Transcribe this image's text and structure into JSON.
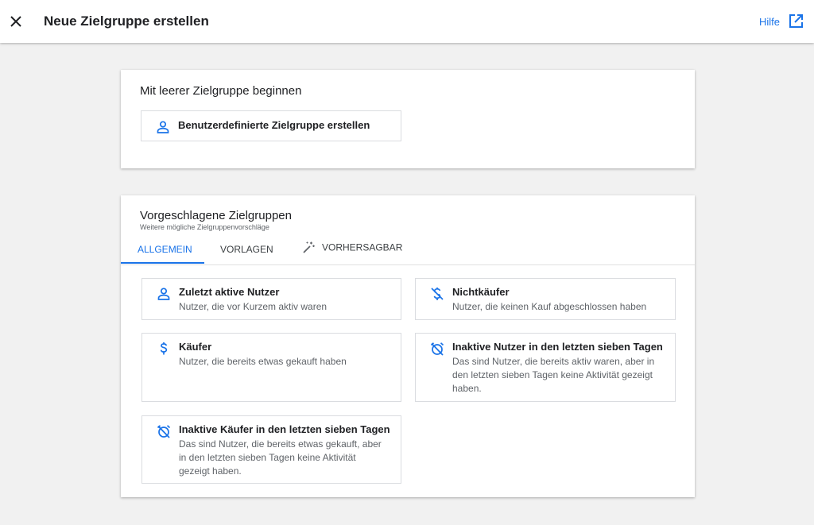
{
  "header": {
    "title": "Neue Zielgruppe erstellen",
    "close_icon": "close-icon",
    "help_label": "Hilfe",
    "help_icon": "open-in-new-icon"
  },
  "blank_section": {
    "title": "Mit leerer Zielgruppe beginnen",
    "custom_option": {
      "icon": "person-icon",
      "label": "Benutzerdefinierte Zielgruppe erstellen"
    }
  },
  "suggested_section": {
    "title": "Vorgeschlagene Zielgruppen",
    "subtitle": "Weitere mögliche Zielgruppenvorschläge",
    "tabs": [
      {
        "label": "ALLGEMEIN",
        "active": true
      },
      {
        "label": "VORLAGEN",
        "active": false
      },
      {
        "label": "VORHERSAGBAR",
        "active": false,
        "icon": "magic-wand-icon"
      }
    ],
    "options": [
      {
        "icon": "person-icon",
        "title": "Zuletzt aktive Nutzer",
        "description": "Nutzer, die vor Kurzem aktiv waren"
      },
      {
        "icon": "money-off-icon",
        "title": "Nichtkäufer",
        "description": "Nutzer, die keinen Kauf abgeschlossen haben"
      },
      {
        "icon": "dollar-icon",
        "title": "Käufer",
        "description": "Nutzer, die bereits etwas gekauft haben"
      },
      {
        "icon": "alarm-off-icon",
        "title": "Inaktive Nutzer in den letzten sieben Tagen",
        "description": "Das sind Nutzer, die bereits aktiv waren, aber in den letzten sieben Tagen keine Aktivität gezeigt haben."
      },
      {
        "icon": "alarm-off-icon",
        "title": "Inaktive Käufer in den letzten sieben Tagen",
        "description": "Das sind Nutzer, die bereits etwas gekauft, aber in den letzten sieben Tagen keine Aktivität gezeigt haben."
      }
    ]
  },
  "colors": {
    "accent": "#1a73e8",
    "background": "#f1f1f1",
    "card": "#ffffff",
    "border": "#dadce0"
  }
}
